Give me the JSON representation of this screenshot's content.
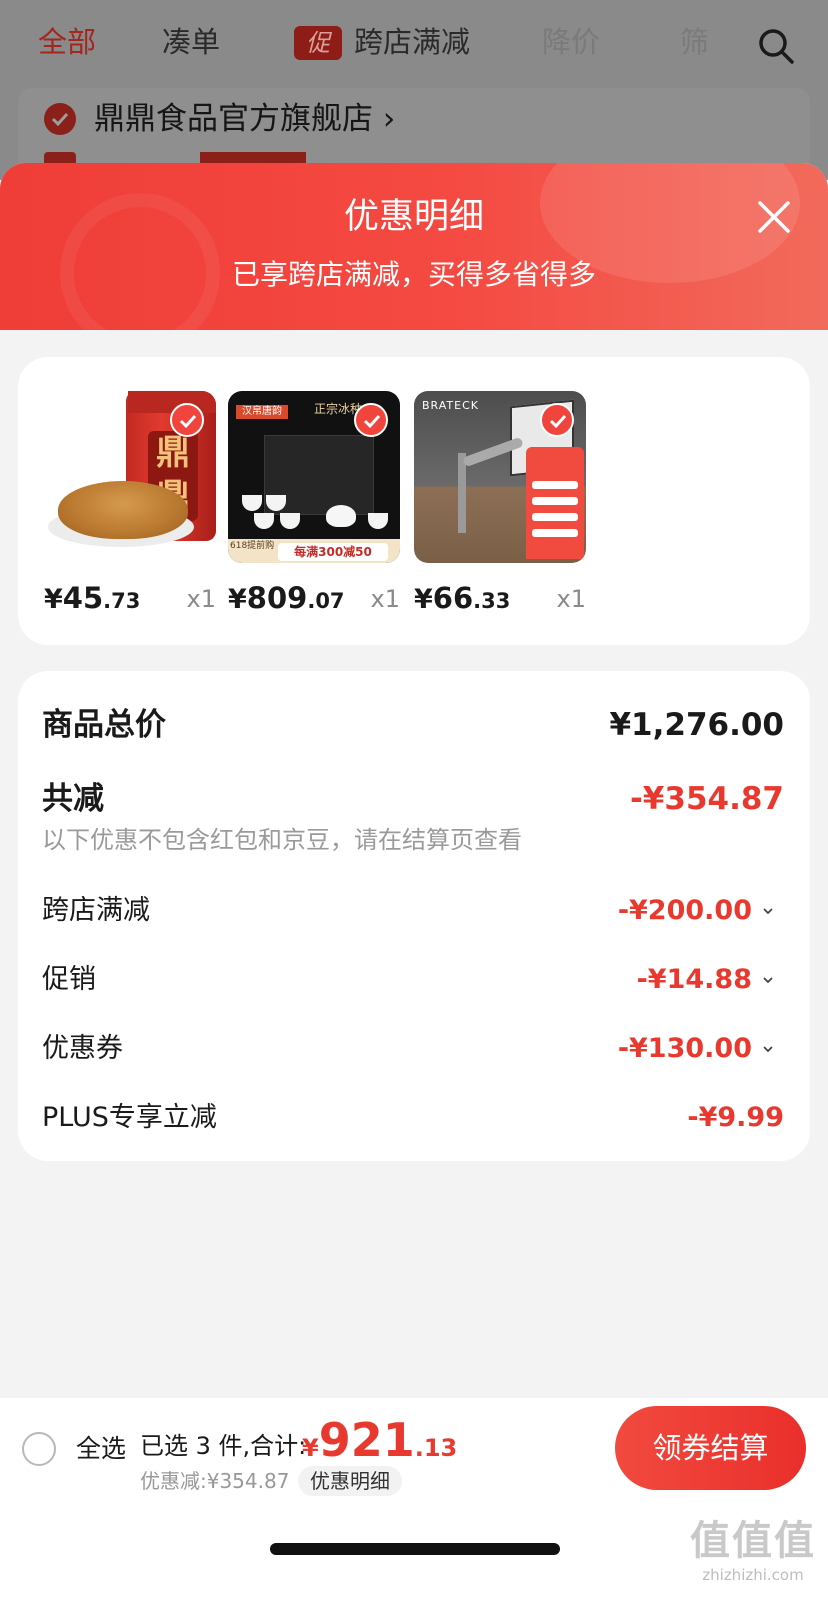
{
  "background_page": {
    "tabs": [
      {
        "label": "全部",
        "active": true
      },
      {
        "label": "凑单"
      },
      {
        "label": "跨店满减",
        "badge": "促"
      },
      {
        "label": "降价",
        "faded": true
      },
      {
        "label": "筛",
        "faded": true
      }
    ],
    "store_name": "鼎鼎食品官方旗舰店 ›"
  },
  "sheet": {
    "title": "优惠明细",
    "subtitle": "已享跨店满减，买得多省得多"
  },
  "products": [
    {
      "name_icon": "pork-floss-jar-image",
      "jar_label": "鼎鼎",
      "price_yuan": "¥",
      "price_int": "45",
      "price_dec": ".73",
      "qty": "x1",
      "selected": true
    },
    {
      "name_icon": "tea-set-image",
      "brand_tag": "汉帛唐韵",
      "product_tag": "正宗冰种",
      "promo_text": "每满300减50",
      "side_text": "618提前购",
      "price_yuan": "¥",
      "price_int": "809",
      "price_dec": ".07",
      "qty": "x1",
      "selected": true
    },
    {
      "name_icon": "monitor-arm-image",
      "brand_tag": "BRATECK",
      "price_yuan": "¥",
      "price_int": "66",
      "price_dec": ".33",
      "qty": "x1",
      "selected": true
    }
  ],
  "summary": {
    "total_label": "商品总价",
    "total_value": "¥1,276.00",
    "reduce_label": "共减",
    "reduce_value": "-¥354.87",
    "hint": "以下优惠不包含红包和京豆，请在结算页查看",
    "items": [
      {
        "label": "跨店满减",
        "value": "-¥200.00",
        "expandable": true
      },
      {
        "label": "促销",
        "value": "-¥14.88",
        "expandable": true
      },
      {
        "label": "优惠券",
        "value": "-¥130.00",
        "expandable": true
      },
      {
        "label": "PLUS专享立减",
        "value": "-¥9.99",
        "expandable": false
      }
    ]
  },
  "bottom_bar": {
    "select_all": "全选",
    "selected_info": "已选 3 件,合计:",
    "total_yuan": "¥",
    "total_int": "921",
    "total_dec": ".13",
    "discount": "优惠减:¥354.87",
    "detail_chip": "优惠明细",
    "checkout": "领券结算"
  },
  "watermark": {
    "big": "值值值",
    "small": "zhizhizhi.com"
  },
  "colors": {
    "accent": "#e8392f",
    "header_red": "#f04338",
    "price_black": "#1a1a1a"
  }
}
